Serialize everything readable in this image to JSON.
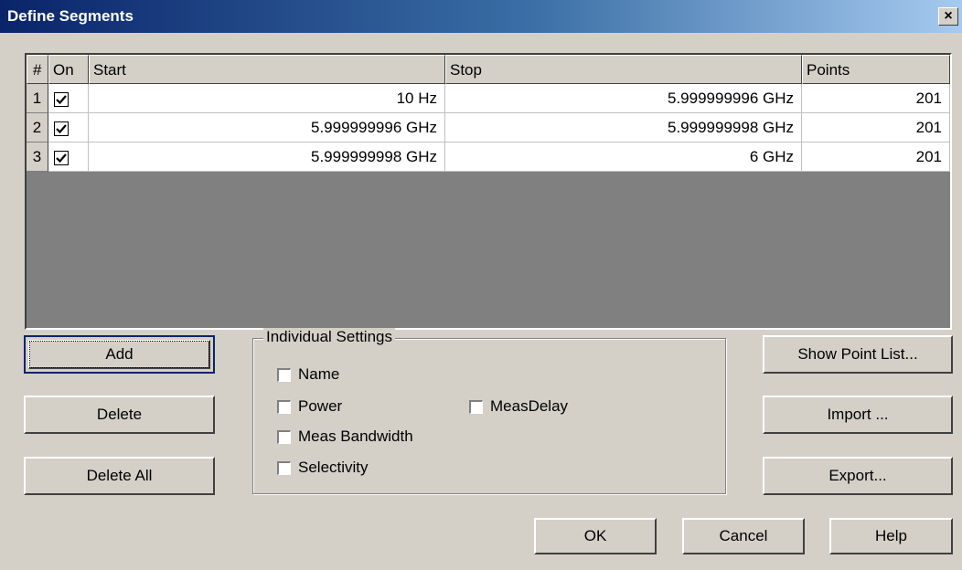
{
  "window": {
    "title": "Define Segments",
    "close_glyph": "×"
  },
  "table": {
    "headers": {
      "num": "#",
      "on": "On",
      "start": "Start",
      "stop": "Stop",
      "points": "Points"
    },
    "rows": [
      {
        "num": "1",
        "on": true,
        "start": "10 Hz",
        "stop": "5.999999996 GHz",
        "points": "201"
      },
      {
        "num": "2",
        "on": true,
        "start": "5.999999996 GHz",
        "stop": "5.999999998 GHz",
        "points": "201"
      },
      {
        "num": "3",
        "on": true,
        "start": "5.999999998 GHz",
        "stop": "6 GHz",
        "points": "201"
      }
    ]
  },
  "left_buttons": {
    "add": "Add",
    "delete": "Delete",
    "delete_all": "Delete All"
  },
  "settings": {
    "title": "Individual Settings",
    "name": "Name",
    "power": "Power",
    "meas_delay": "MeasDelay",
    "meas_bandwidth": "Meas Bandwidth",
    "selectivity": "Selectivity"
  },
  "right_buttons": {
    "show_point_list": "Show Point List...",
    "import": "Import ...",
    "export": "Export..."
  },
  "bottom_buttons": {
    "ok": "OK",
    "cancel": "Cancel",
    "help": "Help"
  }
}
